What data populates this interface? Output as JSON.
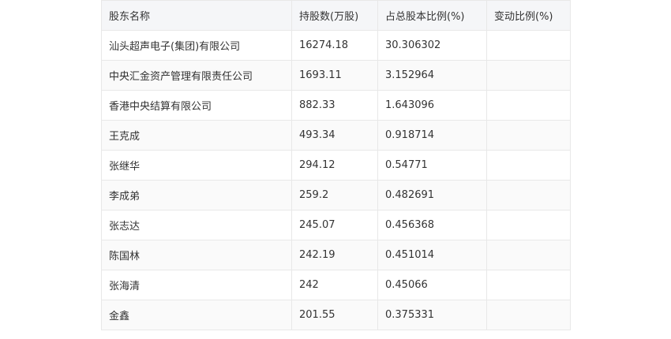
{
  "table": {
    "headers": [
      "股东名称",
      "持股数(万股)",
      "占总股本比例(%)",
      "变动比例(%)"
    ],
    "rows": [
      [
        "汕头超声电子(集团)有限公司",
        "16274.18",
        "30.306302",
        ""
      ],
      [
        "中央汇金资产管理有限责任公司",
        "1693.11",
        "3.152964",
        ""
      ],
      [
        "香港中央结算有限公司",
        "882.33",
        "1.643096",
        ""
      ],
      [
        "王克成",
        "493.34",
        "0.918714",
        ""
      ],
      [
        "张继华",
        "294.12",
        "0.54771",
        ""
      ],
      [
        "李成弟",
        "259.2",
        "0.482691",
        ""
      ],
      [
        "张志达",
        "245.07",
        "0.456368",
        ""
      ],
      [
        "陈国林",
        "242.19",
        "0.451014",
        ""
      ],
      [
        "张海清",
        "242",
        "0.45066",
        ""
      ],
      [
        "金鑫",
        "201.55",
        "0.375331",
        ""
      ]
    ]
  }
}
